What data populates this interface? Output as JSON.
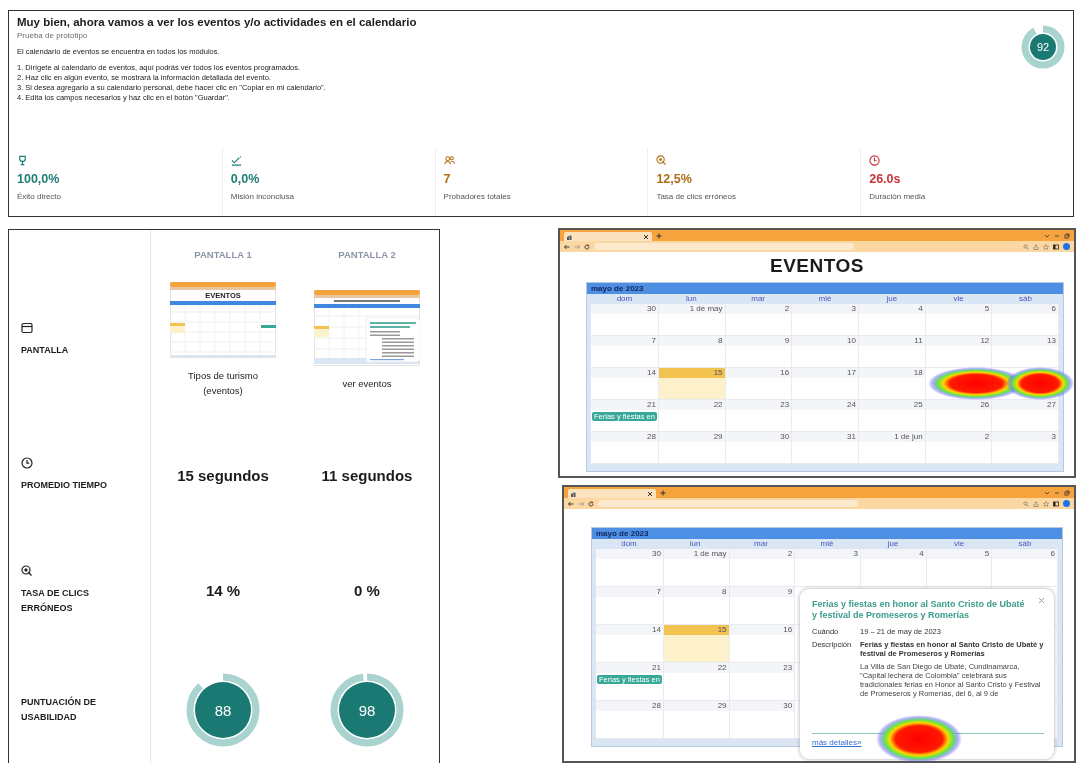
{
  "header": {
    "title": "Muy bien, ahora vamos a ver los eventos y/o actividades en el calendario",
    "subtitle": "Prueba de prototipo",
    "intro": "El calendario de eventos se encuentra en todos los módulos.",
    "steps": [
      "1. Dirígete al calendario de eventos, aquí podrás ver todos los eventos programados.",
      "2. Haz clic en algún evento, se mostrará la información detallada del evento.",
      "3. Si desea agregarlo a su calendario personal, debe hacer clic en \"Copiar en mi calendario\".",
      "4. Edita los campos necesarios y haz clic en el botón \"Guardar\"."
    ],
    "score": {
      "value": "92",
      "level": 0.92
    }
  },
  "metrics": [
    {
      "kind": "trophy",
      "value": "100,0%",
      "label": "Éxito directo",
      "color": "#1d7d76"
    },
    {
      "kind": "unfinished",
      "value": "0,0%",
      "label": "Misión inconclusa",
      "color": "#1d7d76"
    },
    {
      "kind": "people",
      "value": "7",
      "label": "Probadores totales",
      "color": "#b06f17"
    },
    {
      "kind": "misclick",
      "value": "12,5%",
      "label": "Tasa de clics erróneos",
      "color": "#b06f17"
    },
    {
      "kind": "clock",
      "value": "26.0s",
      "label": "Duración media",
      "color": "#c8323a"
    }
  ],
  "comparison": {
    "headings": [
      "PANTALLA 1",
      "PANTALLA 2"
    ],
    "rows": [
      {
        "kind": "screen",
        "label": "PANTALLA",
        "values": [
          {
            "kind": "calendar",
            "title": "EVENTOS",
            "caption": "Tipos de turismo (eventos)"
          },
          {
            "kind": "calendar-popup",
            "caption": "ver eventos"
          }
        ]
      },
      {
        "kind": "time",
        "label": "PROMEDIO TIEMPO",
        "values": [
          "15 segundos",
          "11 segundos"
        ]
      },
      {
        "kind": "misclick",
        "label": "TASA DE CLICS ERRÓNEOS",
        "values": [
          "14 %",
          "0 %"
        ]
      },
      {
        "kind": "usability",
        "label": "PUNTUACIÓN DE USABILIDAD",
        "values": [
          {
            "value": "88",
            "level": 0.88
          },
          {
            "value": "98",
            "level": 0.98
          }
        ]
      }
    ]
  },
  "captures": [
    {
      "kind": "heatmap-double",
      "page_title": "EVENTOS",
      "calendar": {
        "month": "mayo de 2023",
        "weekdays": [
          "dom",
          "lun",
          "mar",
          "mié",
          "jue",
          "vie",
          "sáb"
        ],
        "weeks": [
          [
            {
              "day": "30",
              "today": false
            },
            {
              "day": "1 de may",
              "today": false
            },
            {
              "day": "2",
              "today": false
            },
            {
              "day": "3",
              "today": false
            },
            {
              "day": "4",
              "today": false
            },
            {
              "day": "5",
              "today": false
            },
            {
              "day": "6",
              "today": false
            }
          ],
          [
            {
              "day": "7",
              "today": false
            },
            {
              "day": "8",
              "today": false
            },
            {
              "day": "9",
              "today": false
            },
            {
              "day": "10",
              "today": false
            },
            {
              "day": "11",
              "today": false
            },
            {
              "day": "12",
              "today": false
            },
            {
              "day": "13",
              "today": false
            }
          ],
          [
            {
              "day": "14",
              "today": false
            },
            {
              "day": "15",
              "today": true
            },
            {
              "day": "16",
              "today": false
            },
            {
              "day": "17",
              "today": false
            },
            {
              "day": "18",
              "today": false
            }
          ],
          [
            {
              "day": "21",
              "today": false,
              "event": "Ferias y fiestas en"
            },
            {
              "day": "22",
              "today": false
            },
            {
              "day": "23",
              "today": false
            },
            {
              "day": "24",
              "today": false
            },
            {
              "day": "25",
              "today": false
            },
            {
              "day": "26",
              "today": false
            },
            {
              "day": "27",
              "today": false
            }
          ],
          [
            {
              "day": "28",
              "today": false
            },
            {
              "day": "29",
              "today": false
            },
            {
              "day": "30",
              "today": false
            },
            {
              "day": "31",
              "today": false
            },
            {
              "day": "1 de jun",
              "today": false
            },
            {
              "day": "2",
              "today": false
            },
            {
              "day": "3",
              "today": false
            }
          ]
        ]
      }
    },
    {
      "kind": "heatmap-popup",
      "calendar": {
        "month": "mayo de 2023",
        "weekdays": [
          "dom",
          "lun",
          "mar",
          "mié",
          "jue",
          "vie",
          "sáb"
        ],
        "weeks": [
          [
            {
              "day": "30",
              "today": false
            },
            {
              "day": "1 de may",
              "today": false
            },
            {
              "day": "2",
              "today": false
            },
            {
              "day": "3",
              "today": false
            },
            {
              "day": "4",
              "today": false
            },
            {
              "day": "5",
              "today": false
            },
            {
              "day": "6",
              "today": false
            }
          ],
          [
            {
              "day": "7",
              "today": false
            },
            {
              "day": "8",
              "today": false
            },
            {
              "day": "9",
              "today": false
            }
          ],
          [
            {
              "day": "14",
              "today": false
            },
            {
              "day": "15",
              "today": true
            },
            {
              "day": "16",
              "today": false
            }
          ],
          [
            {
              "day": "21",
              "today": false,
              "event": "Ferias y fiestas en"
            },
            {
              "day": "22",
              "today": false
            },
            {
              "day": "23",
              "today": false
            }
          ],
          [
            {
              "day": "28",
              "today": false
            },
            {
              "day": "29",
              "today": false
            },
            {
              "day": "30",
              "today": false
            }
          ]
        ]
      },
      "popup": {
        "title": "Ferias y fiestas en honor al Santo Cristo de Ubaté y festival de Promeseros y Romerías",
        "when_label": "Cuándo",
        "when": "19 – 21 de may de 2023",
        "description_label": "Descripción",
        "description_title": "Ferias y fiestas en honor al Santo Cristo de Ubaté y festival de Promeseros y Romerías",
        "description": "La Villa de San Diego de Ubaté, Cundinamarca, \"Capital lechera de Colombia\" celebrará sus tradicionales ferias en Honor al Santo Cristo y Festival de Promeseros y Romerías, del 6, al 9 de",
        "link": "más detalles»"
      }
    }
  ]
}
